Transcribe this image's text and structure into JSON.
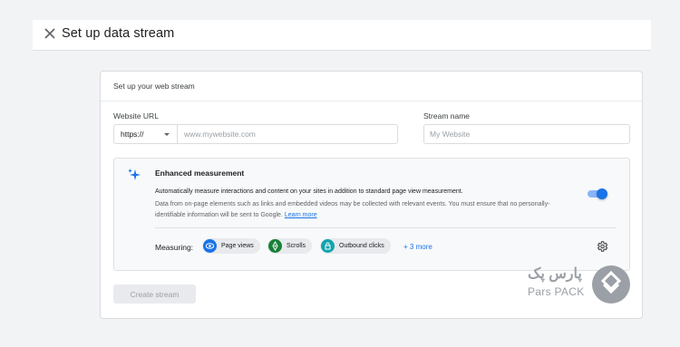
{
  "header": {
    "title": "Set up data stream",
    "close_icon": "close-icon"
  },
  "card": {
    "title": "Set up your web stream",
    "website_url": {
      "label": "Website URL",
      "protocol_value": "https://",
      "placeholder": "www.mywebsite.com"
    },
    "stream_name": {
      "label": "Stream name",
      "placeholder": "My Website"
    },
    "enhanced": {
      "title": "Enhanced measurement",
      "description": "Automatically measure interactions and content on your sites in addition to standard page view measurement.",
      "note": "Data from on-page elements such as links and embedded videos may be collected with relevant events. You must ensure that no personally-identifiable information will be sent to Google.",
      "learn_more": "Learn more",
      "toggle_on": true,
      "measuring_label": "Measuring:",
      "chips": [
        {
          "label": "Page views",
          "icon": "eye-icon",
          "color": "#1a73e8"
        },
        {
          "label": "Scrolls",
          "icon": "crosshair-icon",
          "color": "#188038"
        },
        {
          "label": "Outbound clicks",
          "icon": "lock-icon",
          "color": "#12a4af"
        }
      ],
      "more_label": "+ 3 more"
    },
    "create_button": "Create stream"
  },
  "watermark": {
    "text_fa": "پارس پک",
    "text_en": "Pars PACK"
  },
  "colors": {
    "accent": "#1a73e8",
    "background": "#f1f3f4",
    "disabled": "#e8eaed"
  }
}
